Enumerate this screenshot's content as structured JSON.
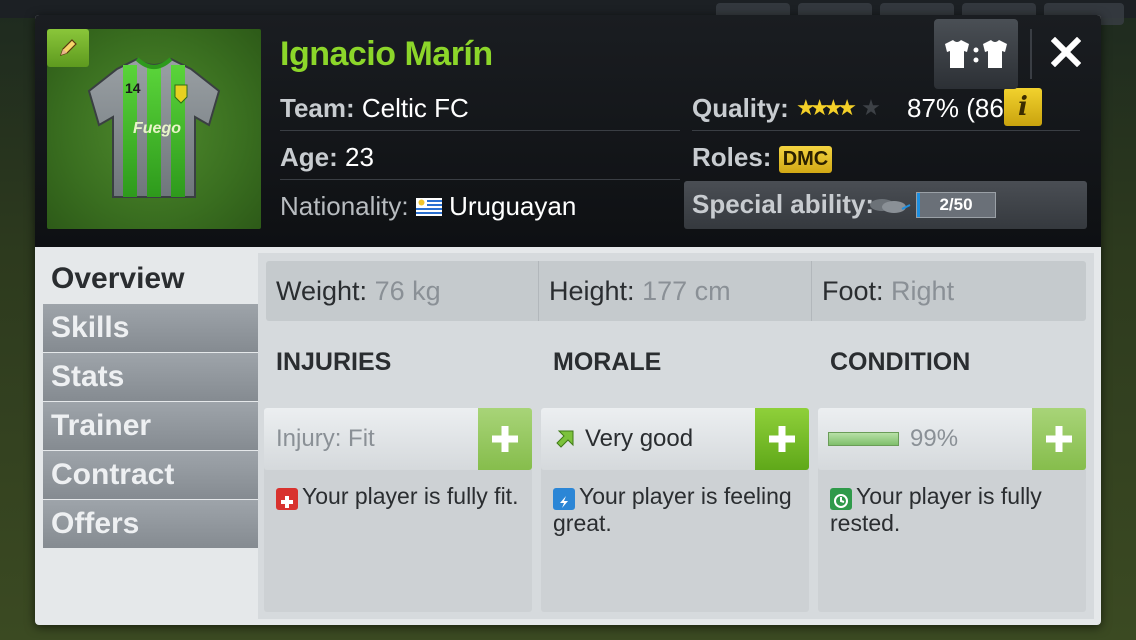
{
  "player": {
    "name": "Ignacio Marín",
    "jersey_number": "14",
    "sponsor": "Fuego"
  },
  "info": {
    "team_label": "Team:",
    "team_value": "Celtic FC",
    "age_label": "Age:",
    "age_value": "23",
    "nationality_label": "Nationality:",
    "nationality_value": "Uruguayan",
    "quality_label": "Quality:",
    "quality_stars": 4,
    "quality_stars_max": 5,
    "quality_value": "87% (86)",
    "roles_label": "Roles:",
    "roles_value": "DMC",
    "special_label": "Special ability:",
    "special_value": "2/50",
    "special_progress": 0.04
  },
  "buttons": {
    "kit_label": "T:T",
    "info_label": "i"
  },
  "tabs": [
    {
      "label": "Overview",
      "active": true
    },
    {
      "label": "Skills",
      "active": false
    },
    {
      "label": "Stats",
      "active": false
    },
    {
      "label": "Trainer",
      "active": false
    },
    {
      "label": "Contract",
      "active": false
    },
    {
      "label": "Offers",
      "active": false
    }
  ],
  "overview": {
    "weight_label": "Weight:",
    "weight_value": "76 kg",
    "height_label": "Height:",
    "height_value": "177 cm",
    "foot_label": "Foot:",
    "foot_value": "Right",
    "injuries": {
      "title": "INJURIES",
      "box_label": "Injury:",
      "box_value": "Fit",
      "message": "Your player is fully fit."
    },
    "morale": {
      "title": "MORALE",
      "box_value": "Very good",
      "message": "Your player is feeling great."
    },
    "condition": {
      "title": "CONDITION",
      "box_value": "99%",
      "level": 0.99,
      "message": "Your player is fully rested."
    }
  },
  "colors": {
    "name_green": "#8cd62a",
    "accent_yellow": "#f2d22e",
    "plus_green": "#5fa819"
  }
}
